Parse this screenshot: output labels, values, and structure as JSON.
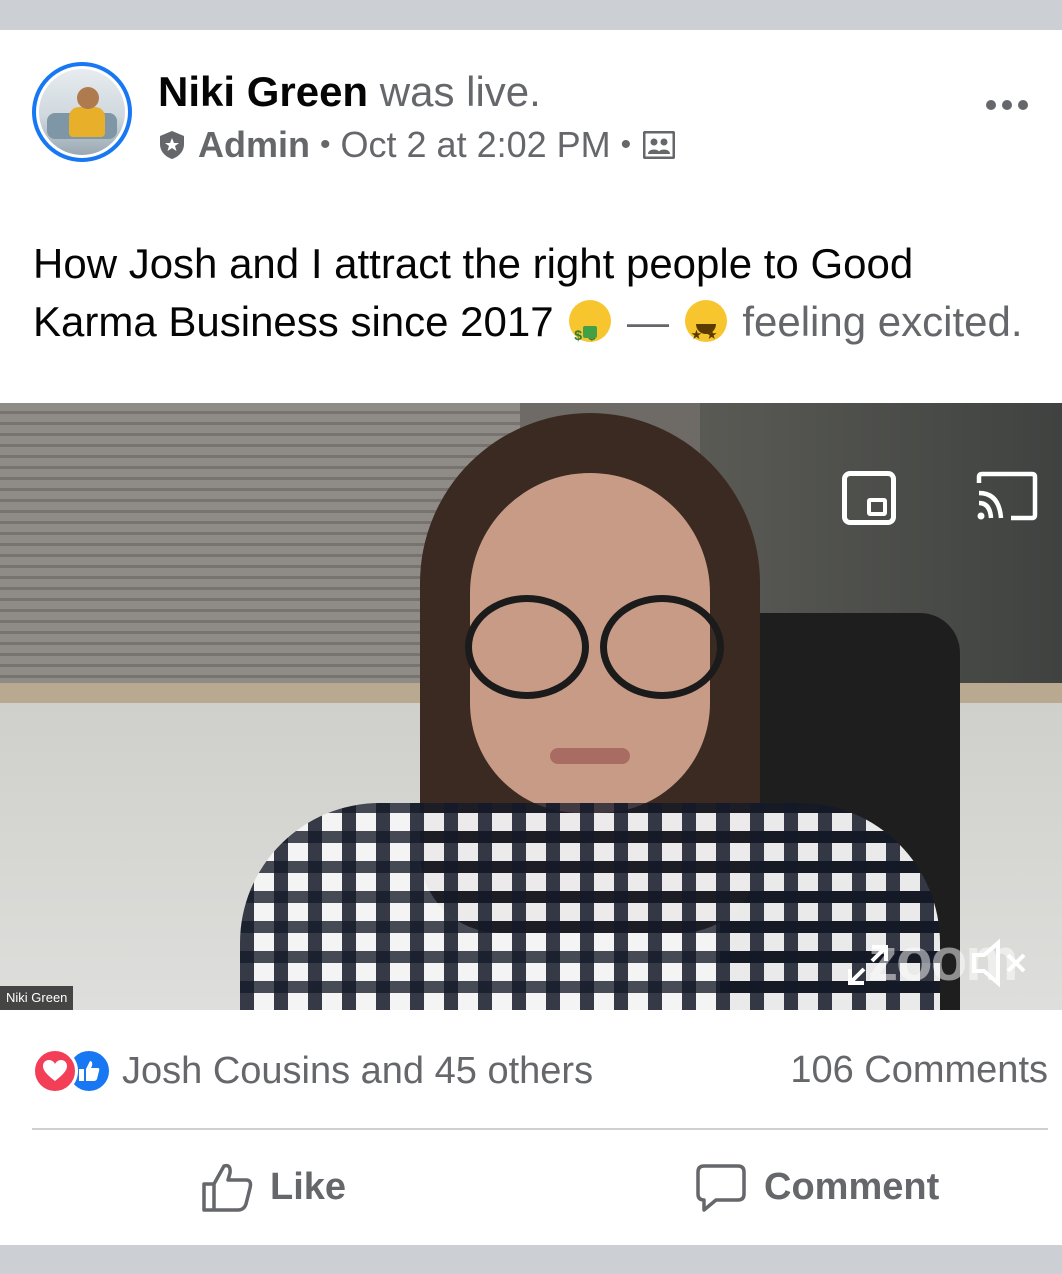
{
  "post": {
    "author": "Niki Green",
    "status": "was live.",
    "role": "Admin",
    "timestamp": "Oct 2 at 2:02 PM",
    "text_main": "How Josh and I attract the right people to Good Karma Business since 2017",
    "dash": "—",
    "feeling_word": "feeling",
    "feeling_value": "excited.",
    "icons": {
      "role": "shield-star-icon",
      "audience": "group-icon",
      "more": "more-options-icon",
      "emoji_1": "money-mouth-face-emoji",
      "emoji_2": "star-struck-emoji"
    }
  },
  "video": {
    "speaker_tag": "Niki Green",
    "watermark": "zoom",
    "controls": [
      "picture-in-picture-icon",
      "cast-icon",
      "expand-icon",
      "mute-icon"
    ]
  },
  "reactions": {
    "summary": "Josh Cousins and 45 others",
    "comments": "106 Comments",
    "icons": [
      "love-reaction-icon",
      "like-reaction-icon"
    ]
  },
  "actions": {
    "like_label": "Like",
    "comment_label": "Comment"
  },
  "colors": {
    "brand_blue": "#1877f2",
    "love_red": "#f33e58",
    "secondary_text": "#65676b",
    "background": "#ccd0d5"
  }
}
